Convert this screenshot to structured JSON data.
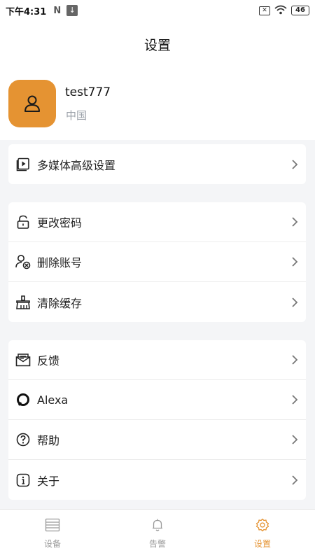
{
  "status_bar": {
    "time": "下午4:31",
    "n_icon": "N",
    "battery": "46"
  },
  "header": {
    "title": "设置",
    "username": "test777",
    "region": "中国"
  },
  "settings": {
    "group1": [
      {
        "label": "多媒体高级设置",
        "icon": "media-icon"
      }
    ],
    "group2": [
      {
        "label": "更改密码",
        "icon": "lock-icon"
      },
      {
        "label": "删除账号",
        "icon": "delete-user-icon"
      },
      {
        "label": "清除缓存",
        "icon": "broom-icon"
      }
    ],
    "group3": [
      {
        "label": "反馈",
        "icon": "feedback-icon"
      },
      {
        "label": "Alexa",
        "icon": "alexa-icon"
      },
      {
        "label": "帮助",
        "icon": "help-icon"
      },
      {
        "label": "关于",
        "icon": "info-icon"
      }
    ]
  },
  "tabbar": [
    {
      "label": "设备",
      "icon": "device-list-icon",
      "active": false
    },
    {
      "label": "告警",
      "icon": "bell-icon",
      "active": false
    },
    {
      "label": "设置",
      "icon": "gear-icon",
      "active": true
    }
  ],
  "colors": {
    "accent": "#e59332",
    "muted": "#9aa0a8"
  }
}
